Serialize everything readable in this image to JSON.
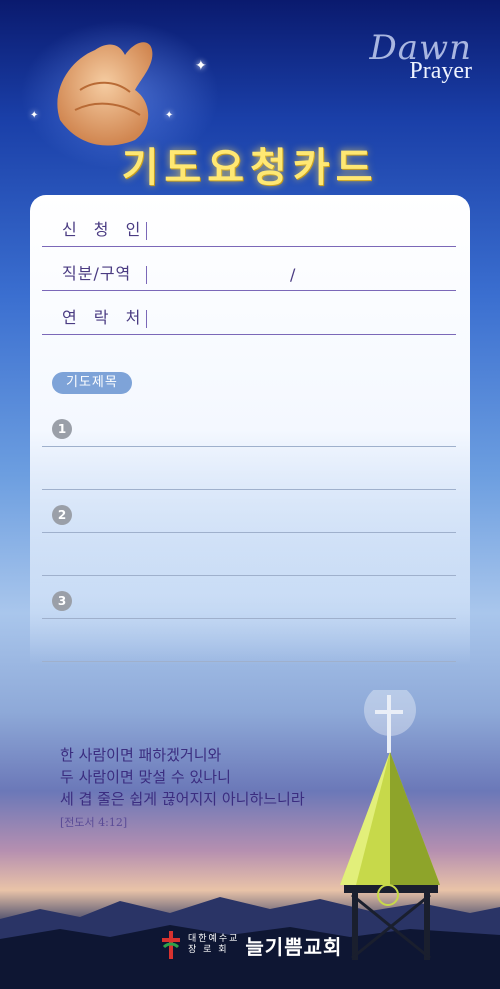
{
  "brand": {
    "logo_script": "Dawn",
    "logo_word": "Prayer"
  },
  "title": "기도요청카드",
  "form": {
    "requester_label": "신 청 인",
    "position_label": "직분/구역",
    "position_separator": "/",
    "contact_label": "연 락 처"
  },
  "prayer": {
    "section_label": "기도제목",
    "items": [
      "1",
      "2",
      "3"
    ]
  },
  "verse": {
    "lines": [
      "한 사람이면 패하겠거니와",
      "두 사람이면 맞설 수 있나니",
      "세 겹 줄은 쉽게 끊어지지 아니하느니라"
    ],
    "reference": "[전도서 4:12]"
  },
  "church": {
    "denomination_line1": "대한예수교",
    "denomination_line2": "장 로 회",
    "name": "늘기쁨교회"
  },
  "colors": {
    "title": "#ffe873",
    "label": "#4a3b82",
    "pill": "#7ea3d8",
    "verse": "#3b2d80"
  }
}
